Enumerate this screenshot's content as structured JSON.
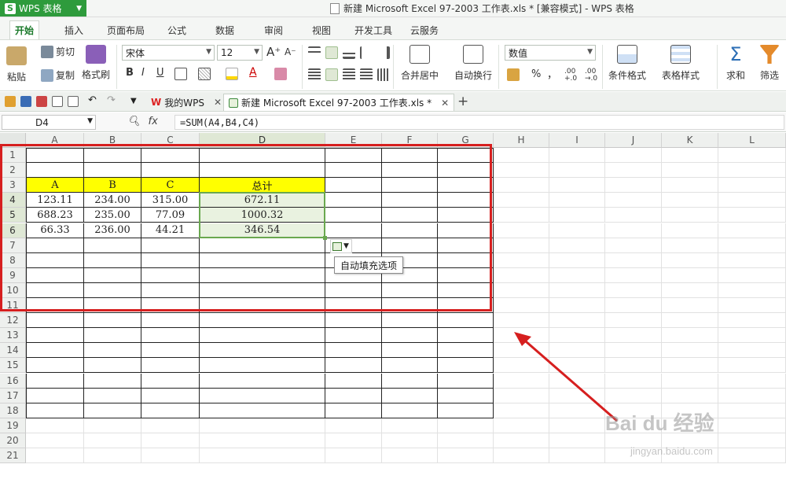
{
  "titlebar": {
    "app_button": "WPS 表格",
    "title": "新建 Microsoft Excel 97-2003 工作表.xls * [兼容模式] - WPS 表格"
  },
  "menu_tabs": [
    "开始",
    "插入",
    "页面布局",
    "公式",
    "数据",
    "审阅",
    "视图",
    "开发工具",
    "云服务"
  ],
  "ribbon": {
    "paste": "粘贴",
    "cut": "剪切",
    "copy": "复制",
    "format_painter": "格式刷",
    "font_name": "宋体",
    "font_size": "12",
    "bold": "B",
    "italic": "I",
    "underline": "U",
    "merge_center": "合并居中",
    "wrap_text": "自动换行",
    "number_format": "数值",
    "percent": "%",
    "comma": "，",
    "dec_inc": ".00 +.0",
    "dec_dec": ".00 →.0",
    "conditional_format": "条件格式",
    "table_style": "表格样式",
    "sum": "求和",
    "filter": "筛选"
  },
  "doc_tabs": {
    "my_wps": "我的WPS",
    "document": "新建 Microsoft Excel 97-2003 工作表.xls *"
  },
  "formula_bar": {
    "name_box": "D4",
    "fx": "fx",
    "formula": "=SUM(A4,B4,C4)"
  },
  "columns": [
    "A",
    "B",
    "C",
    "D",
    "E",
    "F",
    "G",
    "H",
    "I",
    "J",
    "K",
    "L"
  ],
  "rows": [
    "1",
    "2",
    "3",
    "4",
    "5",
    "6",
    "7",
    "8",
    "9",
    "10",
    "11",
    "12",
    "13",
    "14",
    "15",
    "16",
    "17",
    "18",
    "19",
    "20",
    "21"
  ],
  "table": {
    "headers": [
      "A",
      "B",
      "C",
      "总计"
    ],
    "rows": [
      [
        "123.11",
        "234.00",
        "315.00",
        "672.11"
      ],
      [
        "688.23",
        "235.00",
        "77.09",
        "1000.32"
      ],
      [
        "66.33",
        "236.00",
        "44.21",
        "346.54"
      ]
    ]
  },
  "autofill_tooltip": "自动填充选项",
  "watermark": {
    "brand": "Bai du 经验",
    "url": "jingyan.baidu.com"
  },
  "colors": {
    "accent": "#2e9b3c",
    "header_fill": "#ffff00",
    "annotation": "#d61f1f",
    "selection": "#6aa84f"
  }
}
